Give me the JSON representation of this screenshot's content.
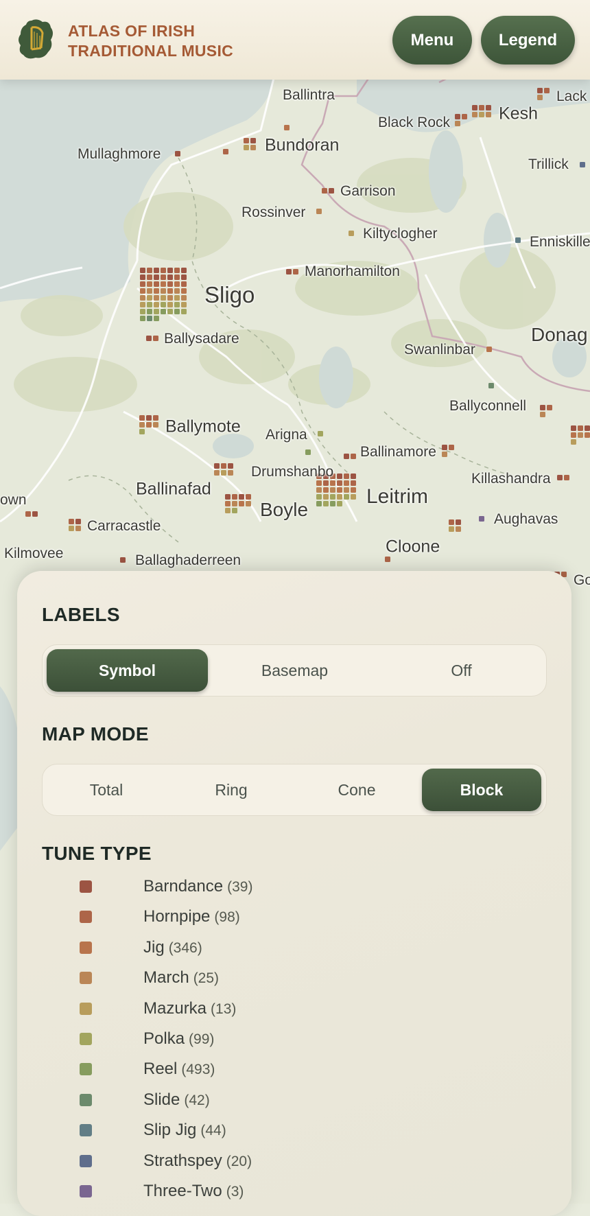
{
  "header": {
    "title_line1": "ATLAS OF IRISH",
    "title_line2": "TRADITIONAL MUSIC",
    "menu_label": "Menu",
    "legend_label": "Legend",
    "logo_icon": "ireland-harp-icon"
  },
  "map": {
    "places": [
      "Ballintra",
      "Black Rock",
      "Kesh",
      "Lack",
      "Mullaghmore",
      "Bundoran",
      "Trillick",
      "Garrison",
      "Rossinver",
      "Kiltyclogher",
      "Enniskille",
      "Manorhamilton",
      "Sligo",
      "Donag",
      "Ballysadare",
      "Swanlinbar",
      "Ballyconnell",
      "Ballymote",
      "Arigna",
      "Ballinamore",
      "Drumshanbo",
      "Killashandra",
      "Ballinafad",
      "Leitrim",
      "own",
      "Boyle",
      "Aughavas",
      "Carracastle",
      "Cloone",
      "Kilmovee",
      "Ballaghaderreen",
      "Go"
    ]
  },
  "panel": {
    "labels_heading": "LABELS",
    "labels_options": [
      "Symbol",
      "Basemap",
      "Off"
    ],
    "labels_selected": "Symbol",
    "mapmode_heading": "MAP MODE",
    "mapmode_options": [
      "Total",
      "Ring",
      "Cone",
      "Block"
    ],
    "mapmode_selected": "Block",
    "tunetype_heading": "TUNE TYPE",
    "tune_types": [
      {
        "name": "Barndance",
        "count": "(39)",
        "color": "#9c5443"
      },
      {
        "name": "Hornpipe",
        "count": "(98)",
        "color": "#ad6548"
      },
      {
        "name": "Jig",
        "count": "(346)",
        "color": "#b8744c"
      },
      {
        "name": "March",
        "count": "(25)",
        "color": "#ba8656"
      },
      {
        "name": "Mazurka",
        "count": "(13)",
        "color": "#b89d5c"
      },
      {
        "name": "Polka",
        "count": "(99)",
        "color": "#a2a55e"
      },
      {
        "name": "Reel",
        "count": "(493)",
        "color": "#869c5e"
      },
      {
        "name": "Slide",
        "count": "(42)",
        "color": "#6c8a6c"
      },
      {
        "name": "Slip Jig",
        "count": "(44)",
        "color": "#627e86"
      },
      {
        "name": "Strathspey",
        "count": "(20)",
        "color": "#5f6e8c"
      },
      {
        "name": "Three-Two",
        "count": "(3)",
        "color": "#7a6690"
      }
    ]
  }
}
